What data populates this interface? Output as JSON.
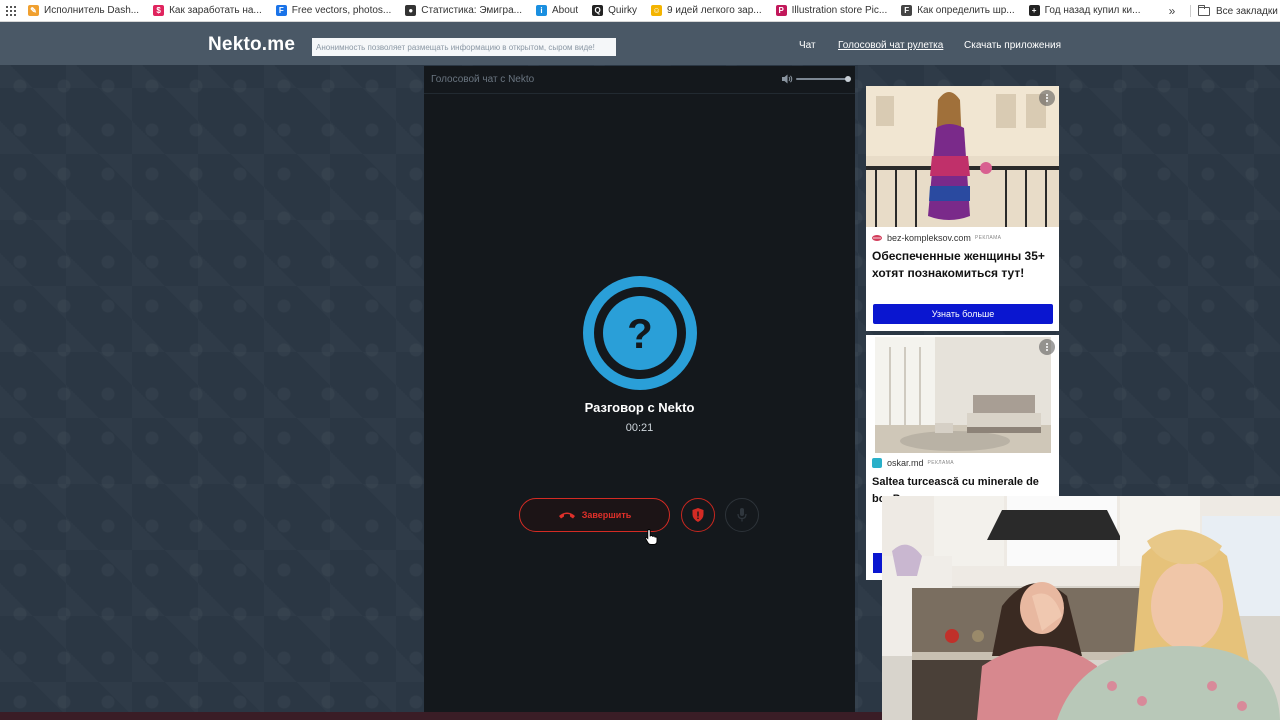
{
  "bookmarks": {
    "items": [
      {
        "label": "Исполнитель Dash...",
        "icon": "pencil-icon",
        "color": "#f0a030"
      },
      {
        "label": "Как заработать на...",
        "icon": "dollar-icon",
        "color": "#e0245e"
      },
      {
        "label": "Free vectors, photos...",
        "icon": "freepik-icon",
        "color": "#1a73e8"
      },
      {
        "label": "Статистика: Эмигра...",
        "icon": "globe-icon",
        "color": "#333333"
      },
      {
        "label": "About",
        "icon": "about-icon",
        "color": "#1a8fe0"
      },
      {
        "label": "Quirky",
        "icon": "quirky-icon",
        "color": "#222222"
      },
      {
        "label": "9 идей легкого зар...",
        "icon": "smile-icon",
        "color": "#f4b400"
      },
      {
        "label": "Illustration store Pic...",
        "icon": "picsart-icon",
        "color": "#c2185b"
      },
      {
        "label": "Как определить шр...",
        "icon": "font-icon",
        "color": "#444444"
      },
      {
        "label": "Год назад купил ки...",
        "icon": "plus-icon",
        "color": "#222222"
      }
    ],
    "more": "»",
    "all_bookmarks": "Все закладки"
  },
  "header": {
    "logo": "Nekto.me",
    "tagline": "Анонимность позволяет размещать информацию в открытом, сыром виде!",
    "nav": [
      {
        "label": "Чат",
        "active": false
      },
      {
        "label": "Голосовой чат рулетка",
        "active": true
      },
      {
        "label": "Скачать приложения",
        "active": false
      }
    ]
  },
  "panel": {
    "title": "Голосовой чат с Nekto",
    "volume": 0.95,
    "call_title": "Разговор с Nekto",
    "timer": "00:21",
    "end_label": "Завершить",
    "accent_color": "#2a9fd8",
    "end_color": "#d42b24"
  },
  "ads": [
    {
      "source": "bez-kompleksov.com",
      "mark": "РЕКЛАМА",
      "title": "Обеспеченные женщины 35+ хотят познакомиться тут!",
      "cta": "Узнать больше"
    },
    {
      "source": "oskar.md",
      "mark": "РЕКЛАМА",
      "title": "Saltea turcească cu minerale de bor Por..."
    }
  ]
}
